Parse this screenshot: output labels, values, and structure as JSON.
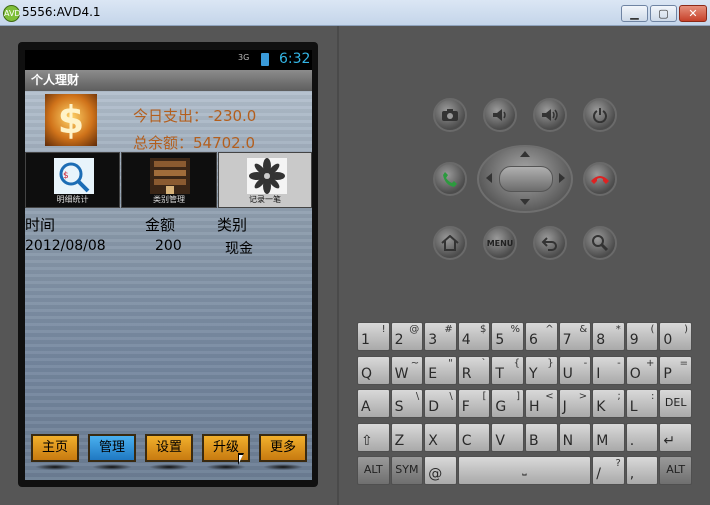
{
  "window": {
    "title": "5556:AVD4.1",
    "icon_label": "AVD",
    "minimize_icon": "minimize-icon",
    "maximize_icon": "maximize-icon",
    "close_icon": "close-icon"
  },
  "statusbar": {
    "signal": "3G",
    "time": "6:32"
  },
  "app": {
    "title": "个人理财",
    "today_spend": "今日支出：-230.0",
    "total_balance": "总余额：54702.0",
    "tiles": [
      {
        "caption": "明细统计",
        "icon": "stats-icon"
      },
      {
        "caption": "类别管理",
        "icon": "category-icon"
      },
      {
        "caption": "记录一笔",
        "icon": "record-icon"
      }
    ],
    "table": {
      "headers": [
        "时间",
        "金额",
        "类别"
      ],
      "rows": [
        [
          "2012/08/08",
          "200",
          "现金"
        ]
      ]
    },
    "nav": [
      "主页",
      "管理",
      "设置",
      "升级",
      "更多"
    ],
    "nav_active": "管理"
  },
  "hardware": {
    "buttons": [
      "camera-icon",
      "volume-down-icon",
      "volume-up-icon",
      "power-icon",
      "call-icon",
      "end-call-icon",
      "home-icon",
      "menu-icon",
      "back-icon",
      "search-icon"
    ],
    "menu_label": "MENU"
  },
  "keyboard": {
    "row1": [
      [
        "1",
        "!"
      ],
      [
        "2",
        "@"
      ],
      [
        "3",
        "#"
      ],
      [
        "4",
        "$"
      ],
      [
        "5",
        "%"
      ],
      [
        "6",
        "^"
      ],
      [
        "7",
        "&"
      ],
      [
        "8",
        "*"
      ],
      [
        "9",
        "("
      ],
      [
        "0",
        ")"
      ]
    ],
    "row2": [
      [
        "Q",
        ""
      ],
      [
        "W",
        "~"
      ],
      [
        "E",
        "\""
      ],
      [
        "R",
        "`"
      ],
      [
        "T",
        "{"
      ],
      [
        "Y",
        "}"
      ],
      [
        "U",
        "-"
      ],
      [
        "I",
        "-"
      ],
      [
        "O",
        "+"
      ],
      [
        "P",
        "="
      ]
    ],
    "row3": [
      [
        "A",
        ""
      ],
      [
        "S",
        "\\"
      ],
      [
        "D",
        "\\"
      ],
      [
        "F",
        "["
      ],
      [
        "G",
        "]"
      ],
      [
        "H",
        "<"
      ],
      [
        "J",
        ">"
      ],
      [
        "K",
        ";"
      ],
      [
        "L",
        ":"
      ],
      [
        "DEL",
        ""
      ]
    ],
    "row4": [
      [
        "⇧",
        ""
      ],
      [
        "Z",
        ""
      ],
      [
        "X",
        ""
      ],
      [
        "C",
        ""
      ],
      [
        "V",
        ""
      ],
      [
        "B",
        ""
      ],
      [
        "N",
        ""
      ],
      [
        "M",
        ""
      ],
      [
        ".",
        ""
      ],
      [
        "↵",
        ""
      ]
    ],
    "row5": [
      [
        "ALT",
        ""
      ],
      [
        "SYM",
        ""
      ],
      [
        "@",
        ""
      ],
      [
        "space",
        ""
      ],
      [
        "/",
        "?"
      ],
      [
        ",",
        ""
      ],
      [
        "ALT",
        ""
      ]
    ]
  }
}
